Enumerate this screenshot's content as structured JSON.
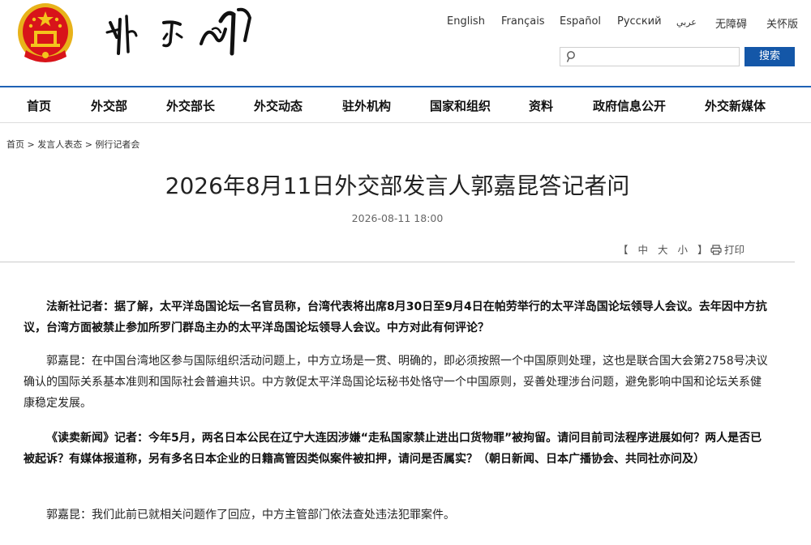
{
  "languages": [
    "English",
    "Français",
    "Español",
    "Русский",
    "عربي",
    "无障碍",
    "关怀版"
  ],
  "search": {
    "placeholder": "",
    "button": "搜索"
  },
  "nav": [
    "首页",
    "外交部",
    "外交部长",
    "外交动态",
    "驻外机构",
    "国家和组织",
    "资料",
    "政府信息公开",
    "外交新媒体"
  ],
  "breadcrumb": "首页 > 发言人表态 > 例行记者会",
  "article": {
    "title": "2026年8月11日外交部发言人郭嘉昆答记者问",
    "date": "2026-08-11 18:00",
    "font_controls": [
      "【",
      "中",
      "大",
      "小",
      "】"
    ],
    "print": "打印",
    "paragraphs": [
      "法新社记者：据了解，太平洋岛国论坛一名官员称，台湾代表将出席8月30日至9月4日在帕劳举行的太平洋岛国论坛领导人会议。去年因中方抗议，台湾方面被禁止参加所罗门群岛主办的太平洋岛国论坛领导人会议。中方对此有何评论？",
      "郭嘉昆：在中国台湾地区参与国际组织活动问题上，中方立场是一贯、明确的，即必须按照一个中国原则处理，这也是联合国大会第2758号决议确认的国际关系基本准则和国际社会普遍共识。中方敦促太平洋岛国论坛秘书处恪守一个中国原则，妥善处理涉台问题，避免影响中国和论坛关系健康稳定发展。",
      "《读卖新闻》记者：今年5月，两名日本公民在辽宁大连因涉嫌“走私国家禁止进出口货物罪”被拘留。请问目前司法程序进展如何？两人是否已被起诉？有媒体报道称，另有多名日本企业的日籍高管因类似案件被扣押，请问是否属实？（朝日新闻、日本广播协会、共同社亦问及）",
      "郭嘉昆：我们此前已就相关问题作了回应，中方主管部门依法查处违法犯罪案件。"
    ]
  },
  "colors": {
    "accent_blue": "#1457a8",
    "emblem_red": "#d8141a",
    "emblem_gold": "#f4c41c"
  }
}
